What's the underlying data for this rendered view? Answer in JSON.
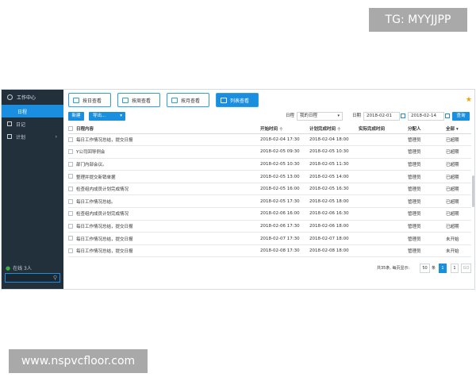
{
  "watermarks": {
    "top": "TG: MYYJJPP",
    "bottom": "www.nspvcfloor.com"
  },
  "sidebar": {
    "header": "工作中心",
    "items": [
      {
        "label": "日程",
        "active": true
      },
      {
        "label": "日记",
        "active": false
      },
      {
        "label": "计划",
        "active": false,
        "chevron": "›"
      }
    ],
    "online": "在线 3人"
  },
  "view_tabs": [
    {
      "label": "按日查看",
      "active": false
    },
    {
      "label": "按周查看",
      "active": false
    },
    {
      "label": "按月查看",
      "active": false
    },
    {
      "label": "列表查看",
      "active": true
    }
  ],
  "toolbar": {
    "new_label": "新建",
    "export_label": "导出...",
    "schedule_label": "日程",
    "schedule_value": "我的日程",
    "date_label": "日期",
    "date_from": "2018-02-01",
    "date_to": "2018-02-14",
    "query_label": "查询"
  },
  "table": {
    "columns": [
      "日程内容",
      "开始时间",
      "计划完成时间",
      "实际完成时间",
      "分配人",
      "全部"
    ],
    "rows": [
      [
        "每日工作情况总结，提交日报",
        "2018-02-04 17:30",
        "2018-02-04 18:00",
        "",
        "管理员",
        "已超期"
      ],
      [
        "Y公司回导例会",
        "2018-02-05 09:30",
        "2018-02-05 10:30",
        "",
        "管理员",
        "已超期"
      ],
      [
        "部门内部会议。",
        "2018-02-05 10:30",
        "2018-02-05 11:30",
        "",
        "管理员",
        "已超期"
      ],
      [
        "整理并提交新销单据",
        "2018-02-05 13:00",
        "2018-02-05 14:00",
        "",
        "管理员",
        "已超期"
      ],
      [
        "检查组内成员计划完成情况",
        "2018-02-05 16:00",
        "2018-02-05 16:30",
        "",
        "管理员",
        "已超期"
      ],
      [
        "每日工作情况总结。",
        "2018-02-05 17:30",
        "2018-02-05 18:00",
        "",
        "管理员",
        "已超期"
      ],
      [
        "检查组内成员计划完成情况",
        "2018-02-06 16:00",
        "2018-02-06 16:30",
        "",
        "管理员",
        "已超期"
      ],
      [
        "每日工作情况总结，提交日报",
        "2018-02-06 17:30",
        "2018-02-06 18:00",
        "",
        "管理员",
        "已超期"
      ],
      [
        "每日工作情况总结，提交日报",
        "2018-02-07 17:30",
        "2018-02-07 18:00",
        "",
        "管理员",
        "未开始"
      ],
      [
        "每日工作情况总结，提交日报",
        "2018-02-08 17:30",
        "2018-02-08 18:00",
        "",
        "管理员",
        "未开始"
      ]
    ]
  },
  "pager": {
    "summary": "共35条, 每页显示:",
    "page_size": "50",
    "unit": "条",
    "current_page": "1",
    "page_num": "1",
    "go_label": "GO"
  },
  "icons": {
    "star": "★",
    "sort": "≑",
    "caret": "▾",
    "search": "⚲",
    "person": "👤"
  },
  "colors": {
    "accent": "#1a8fe0",
    "sidebar_bg": "#22303c",
    "star": "#f2a20c",
    "online": "#3fae49"
  }
}
